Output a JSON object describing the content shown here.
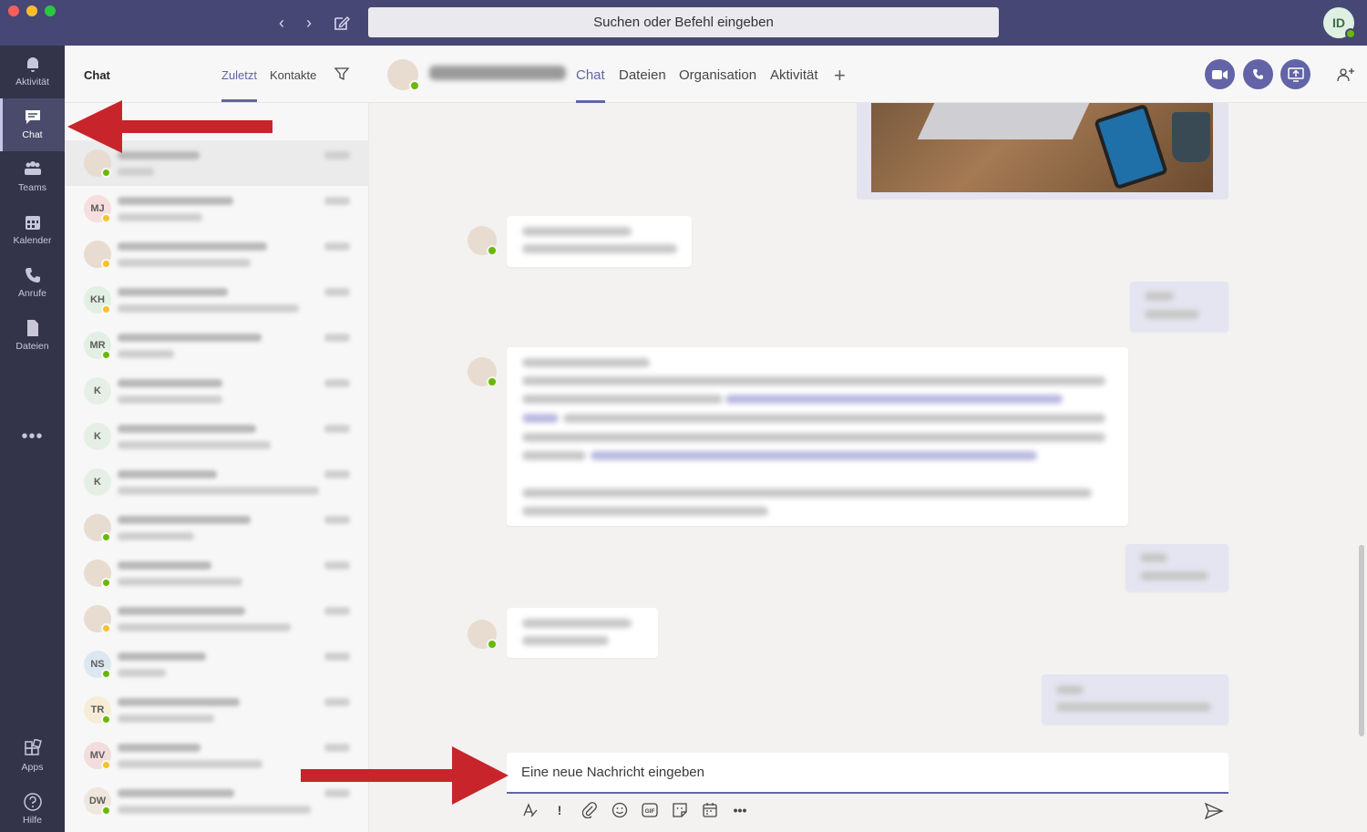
{
  "window": {
    "search_placeholder": "Suchen oder Befehl eingeben",
    "user_initials": "ID"
  },
  "rail": {
    "items": [
      {
        "label": "Aktivität",
        "icon": "bell-icon"
      },
      {
        "label": "Chat",
        "icon": "chat-icon",
        "active": true
      },
      {
        "label": "Teams",
        "icon": "teams-icon"
      },
      {
        "label": "Kalender",
        "icon": "calendar-icon"
      },
      {
        "label": "Anrufe",
        "icon": "phone-icon"
      },
      {
        "label": "Dateien",
        "icon": "file-icon"
      }
    ],
    "more": "•••",
    "apps": "Apps",
    "help": "Hilfe"
  },
  "chatlist": {
    "title": "Chat",
    "tabs": [
      "Zuletzt",
      "Kontakte"
    ],
    "rows": [
      {
        "initials": "",
        "status": "green"
      },
      {
        "initials": "MJ",
        "status": "yellow"
      },
      {
        "initials": "",
        "status": "yellow"
      },
      {
        "initials": "KH",
        "status": "yellow"
      },
      {
        "initials": "MR",
        "status": "green"
      },
      {
        "initials": "K",
        "status": ""
      },
      {
        "initials": "K",
        "status": ""
      },
      {
        "initials": "K",
        "status": ""
      },
      {
        "initials": "",
        "status": "green"
      },
      {
        "initials": "",
        "status": "green"
      },
      {
        "initials": "",
        "status": "yellow"
      },
      {
        "initials": "NS",
        "status": "green"
      },
      {
        "initials": "TR",
        "status": "green"
      },
      {
        "initials": "MV",
        "status": "yellow"
      },
      {
        "initials": "DW",
        "status": "green"
      }
    ]
  },
  "conversation": {
    "tabs": [
      "Chat",
      "Dateien",
      "Organisation",
      "Aktivität"
    ],
    "compose_placeholder": "Eine neue Nachricht eingeben"
  },
  "colors": {
    "accent": "#6264a7",
    "titlebar": "#464775",
    "rail": "#33344a",
    "annotation": "#c8242b"
  }
}
